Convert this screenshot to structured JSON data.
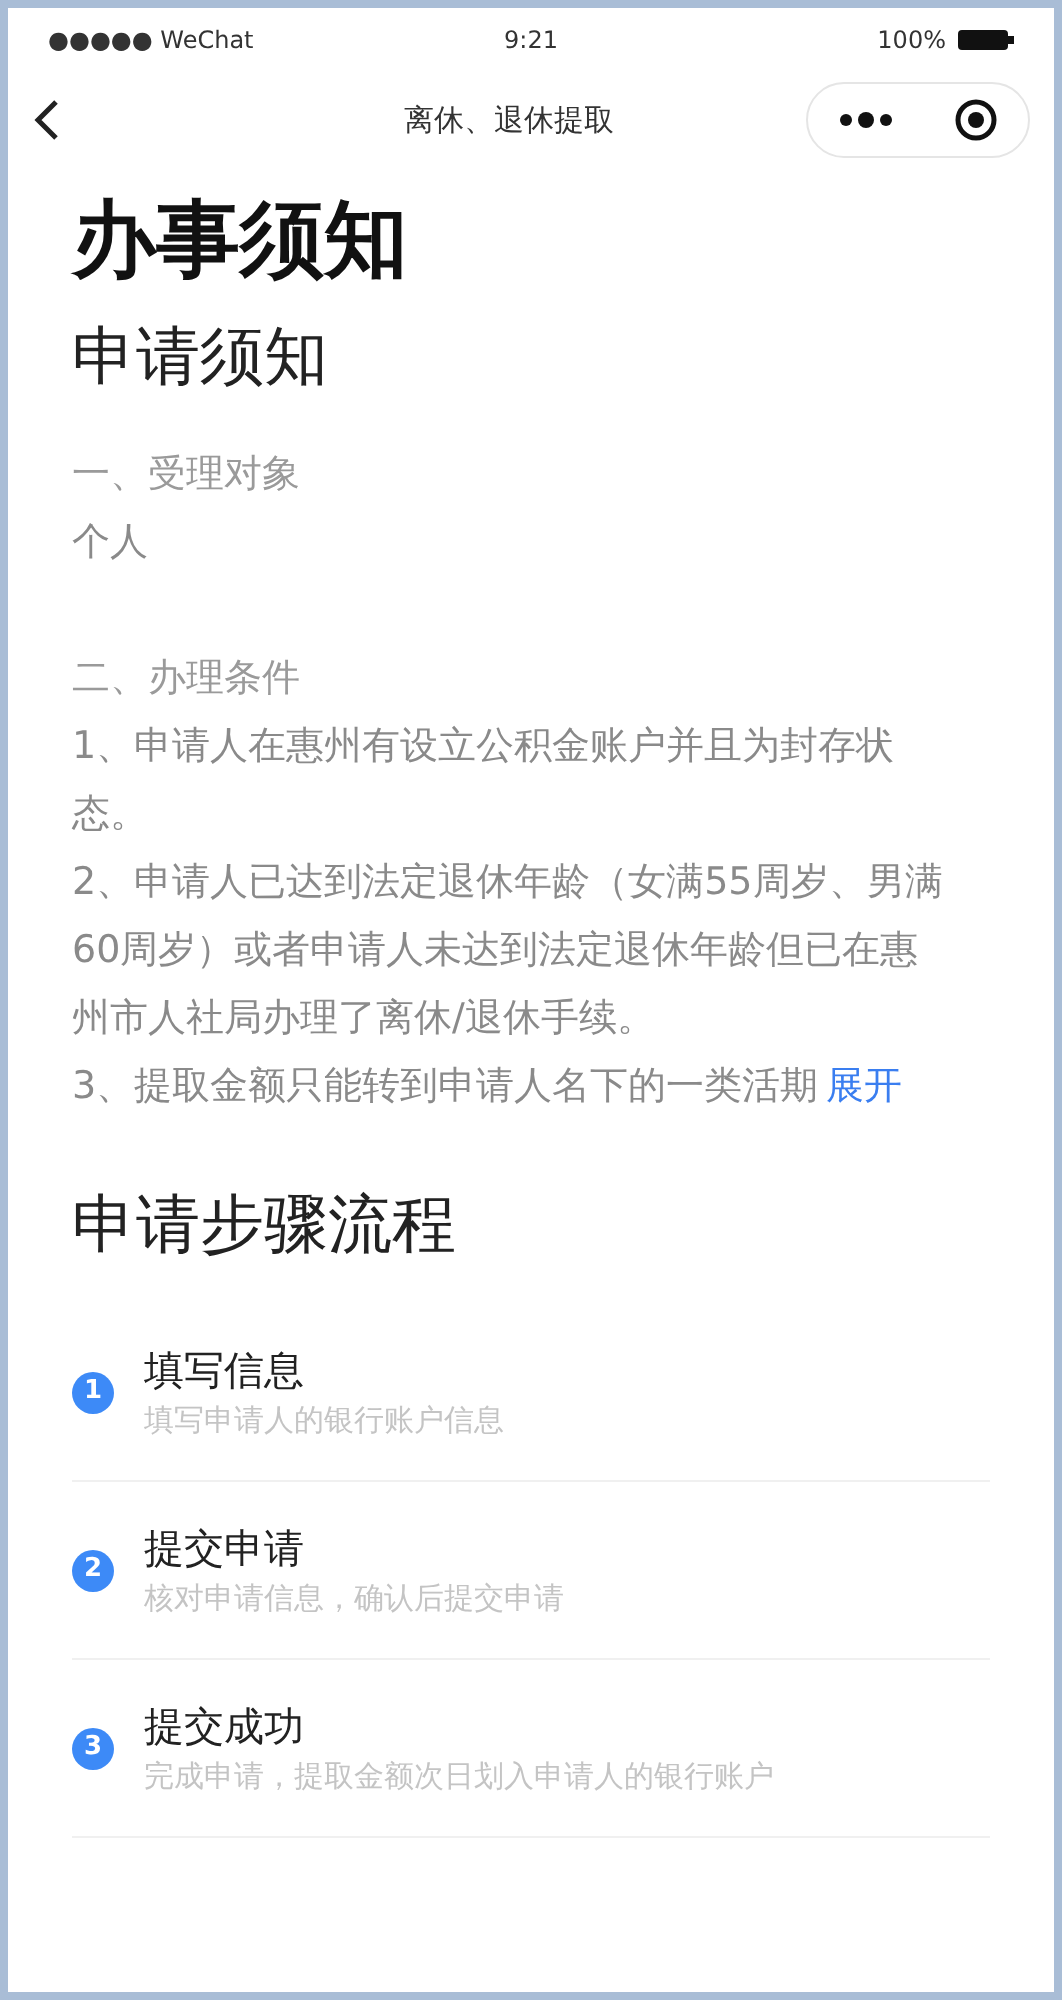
{
  "status_bar": {
    "carrier": "●●●●● WeChat",
    "time": "9:21",
    "battery": "100%"
  },
  "nav_bar": {
    "title": "离休、退休提取"
  },
  "page_title": "办事须知",
  "notice": {
    "heading": "申请须知",
    "paragraphs": [
      {
        "kind": "label",
        "text": "一、受理对象"
      },
      {
        "kind": "text",
        "text": "个人"
      },
      {
        "kind": "gap"
      },
      {
        "kind": "label",
        "text": "二、办理条件"
      },
      {
        "kind": "text",
        "text": "1、申请人在惠州有设立公积金账户并且为封存状态。"
      },
      {
        "kind": "text",
        "text": "2、申请人已达到法定退休年龄（女满55周岁、男满60周岁）或者申请人未达到法定退休年龄但已在惠州市人社局办理了离休/退休手续。"
      },
      {
        "kind": "truncated",
        "text": "3、提取金额只能转到申请人名下的一类活期",
        "link": "展开"
      }
    ]
  },
  "steps": {
    "heading": "申请步骤流程",
    "items": [
      {
        "number": "1",
        "title": "填写信息",
        "description": "填写申请人的银行账户信息"
      },
      {
        "number": "2",
        "title": "提交申请",
        "description": "核对申请信息，确认后提交申请"
      },
      {
        "number": "3",
        "title": "提交成功",
        "description": "完成申请，提取金额次日划入申请人的银行账户"
      }
    ]
  }
}
